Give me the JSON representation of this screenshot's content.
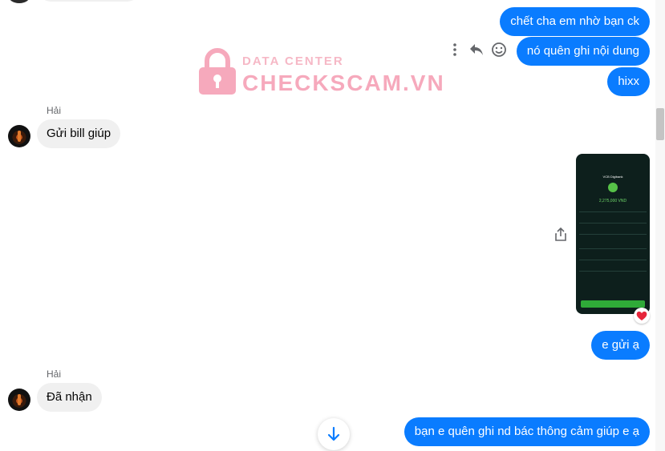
{
  "watermark": {
    "line1": "DATA CENTER",
    "line2": "CHECKSCAM.VN"
  },
  "messages": {
    "out_1": "chết cha em nhờ bạn ck",
    "out_2": "nó quên ghi nội dung",
    "out_3": "hixx",
    "in_sender_1": "Hải",
    "in_1": "Gửi bill giúp",
    "out_4": "e gửi ạ",
    "in_sender_2": "Hải",
    "in_2": "Đã nhận",
    "out_5": "bạn e quên ghi nd bác thông cảm giúp e ạ"
  },
  "phone_screenshot": {
    "app_title": "VCB Digibank",
    "amount": "2,275,000 VND"
  },
  "icons": {
    "more": "more-vertical-icon",
    "reply": "reply-icon",
    "react": "emoji-icon",
    "share": "share-icon",
    "reaction": "heart-icon",
    "scroll": "arrow-down-icon"
  },
  "colors": {
    "outgoing_bubble": "#0a7cff",
    "incoming_bubble": "#f0f0f0",
    "watermark": "#f6a9bc"
  }
}
